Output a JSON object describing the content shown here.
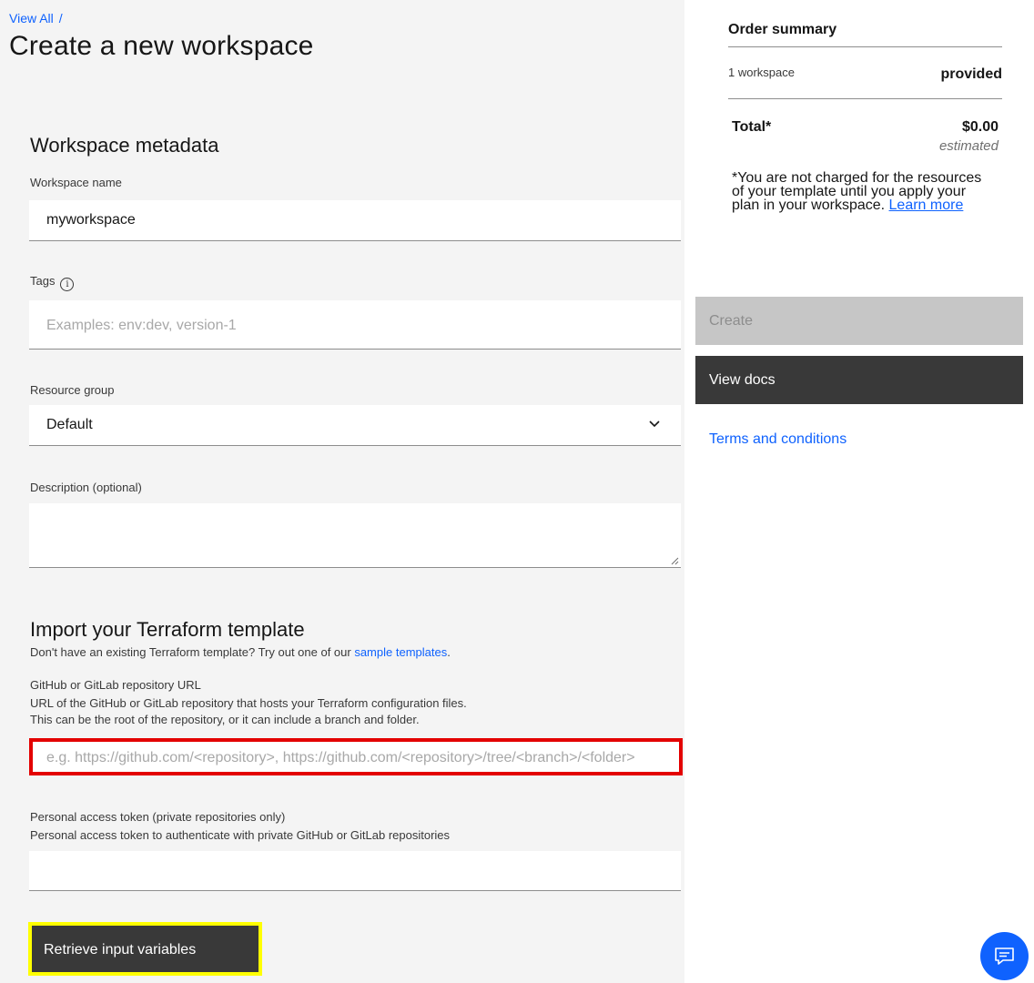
{
  "breadcrumb": {
    "link": "View All",
    "separator": "/"
  },
  "page": {
    "title": "Create a new workspace"
  },
  "metadata": {
    "section_title": "Workspace metadata",
    "name_label": "Workspace name",
    "name_value": "myworkspace",
    "tags_label": "Tags",
    "tags_placeholder": "Examples: env:dev, version-1",
    "resource_group_label": "Resource group",
    "resource_group_value": "Default",
    "description_label": "Description (optional)",
    "description_value": ""
  },
  "template": {
    "section_title": "Import your Terraform template",
    "intro_text": "Don't have an existing Terraform template? Try out one of our ",
    "intro_link": "sample templates",
    "intro_end": ".",
    "url_label": "GitHub or GitLab repository URL",
    "url_help_1": "URL of the GitHub or GitLab repository that hosts your Terraform configuration files.",
    "url_help_2": "This can be the root of the repository, or it can include a branch and folder.",
    "url_placeholder": "e.g. https://github.com/<repository>, https://github.com/<repository>/tree/<branch>/<folder>",
    "token_label": "Personal access token (private repositories only)",
    "token_help": "Personal access token to authenticate with private GitHub or GitLab repositories",
    "retrieve_button": "Retrieve input variables"
  },
  "summary": {
    "title": "Order summary",
    "item_label": "1 workspace",
    "item_value": "provided",
    "total_label": "Total*",
    "total_value": "$0.00",
    "estimated": "estimated",
    "note": "*You are not charged for the resources of your template until you apply your plan in your workspace. ",
    "learn_more": "Learn more"
  },
  "actions": {
    "create": "Create",
    "view_docs": "View docs",
    "terms": "Terms and conditions"
  },
  "icons": [
    "info-icon",
    "chevron-down-icon",
    "resize-handle-icon",
    "chat-icon"
  ],
  "colors": {
    "link": "#0f62fe",
    "dark_button": "#393939",
    "disabled_button": "#c6c6c6",
    "highlight_red": "#e30000",
    "highlight_yellow": "#ffff00"
  }
}
